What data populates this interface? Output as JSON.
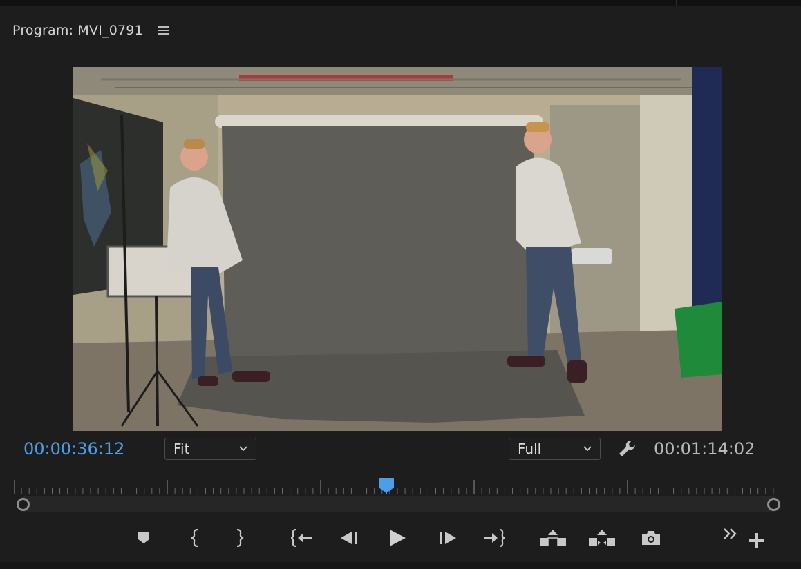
{
  "panel": {
    "title": "Program: MVI_0791",
    "menu_icon": "hamburger-menu-icon"
  },
  "viewer": {
    "content": "video-frame"
  },
  "transport_info": {
    "current_timecode": "00:00:36:12",
    "duration_timecode": "00:01:14:02",
    "zoom_level": "Fit",
    "playback_resolution": "Full",
    "settings_icon": "wrench-icon"
  },
  "timeline": {
    "playhead_fraction": 0.49
  },
  "controls": {
    "buttons": [
      {
        "name": "add-marker-button",
        "icon": "marker-icon"
      },
      {
        "name": "mark-in-button",
        "icon": "mark-in-icon"
      },
      {
        "name": "mark-out-button",
        "icon": "mark-out-icon"
      },
      {
        "name": "go-to-in-button",
        "icon": "go-to-in-icon"
      },
      {
        "name": "step-back-button",
        "icon": "step-back-icon"
      },
      {
        "name": "play-button",
        "icon": "play-icon"
      },
      {
        "name": "step-forward-button",
        "icon": "step-forward-icon"
      },
      {
        "name": "go-to-out-button",
        "icon": "go-to-out-icon"
      },
      {
        "name": "lift-button",
        "icon": "lift-icon"
      },
      {
        "name": "extract-button",
        "icon": "extract-icon"
      },
      {
        "name": "export-frame-button",
        "icon": "camera-icon"
      },
      {
        "name": "more-controls-button",
        "icon": "double-chevron-right-icon"
      },
      {
        "name": "button-editor-button",
        "icon": "plus-icon"
      }
    ]
  },
  "colors": {
    "accent": "#4a9fe8",
    "panel_bg": "#1d1d1d",
    "text": "#d6d6d6"
  }
}
